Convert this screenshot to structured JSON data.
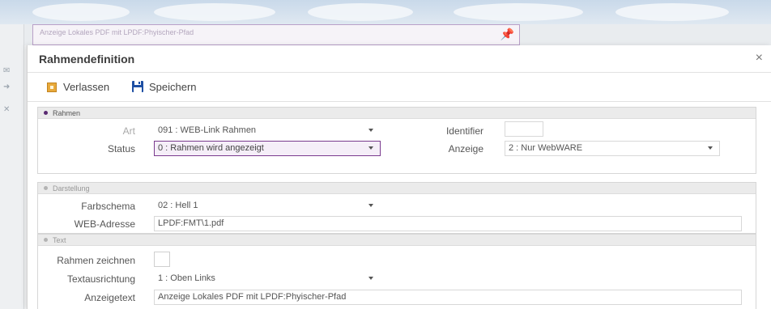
{
  "background": {
    "panel_title": "Anzeige Lokales PDF mit LPDF:Phyischer-Pfad"
  },
  "dialog": {
    "title": "Rahmendefinition",
    "close_glyph": "×"
  },
  "toolbar": {
    "exit_label": "Verlassen",
    "save_label": "Speichern"
  },
  "sections": {
    "rahmen": {
      "title": "Rahmen",
      "art_label": "Art",
      "art_value": "091 : WEB-Link Rahmen",
      "status_label": "Status",
      "status_value": "0 : Rahmen wird angezeigt",
      "identifier_label": "Identifier",
      "identifier_value": "",
      "anzeige_label": "Anzeige",
      "anzeige_value": "2 : Nur WebWARE"
    },
    "darstellung": {
      "title": "Darstellung",
      "farbschema_label": "Farbschema",
      "farbschema_value": "02 : Hell 1",
      "webadresse_label": "WEB-Adresse",
      "webadresse_value": "LPDF:FMT\\1.pdf"
    },
    "text": {
      "title": "Text",
      "rahmen_zeichnen_label": "Rahmen zeichnen",
      "rahmen_zeichnen_checked": false,
      "textausrichtung_label": "Textausrichtung",
      "textausrichtung_value": "1 : Oben Links",
      "anzeigetext_label": "Anzeigetext",
      "anzeigetext_value": "Anzeige Lokales PDF mit LPDF:Phyischer-Pfad"
    }
  },
  "colors": {
    "accent": "#5a2a72",
    "focus_border": "#7a3b8e",
    "exit_icon": "#e8a93a",
    "save_icon": "#1e4fa3"
  },
  "icons": {
    "exit": "exit-icon",
    "save": "floppy-disk-icon",
    "close": "close-icon",
    "pin": "pin-icon"
  }
}
